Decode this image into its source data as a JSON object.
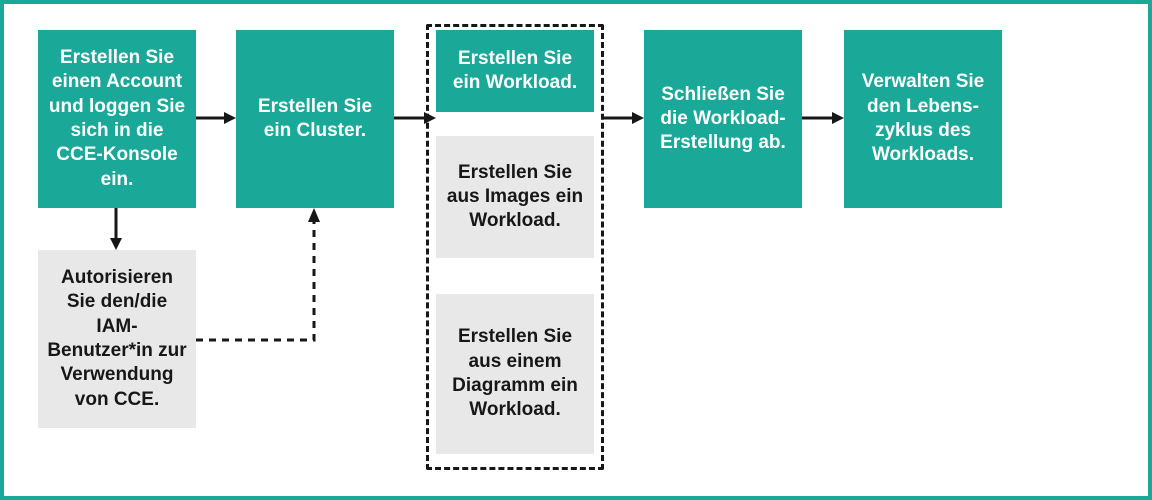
{
  "step1": "Erstellen Sie einen Account und loggen Sie sich in die CCE-Konsole ein.",
  "step1_sub": "Autorisieren Sie den/die IAM-Benutzer*in zur Verwendung von CCE.",
  "step2": "Erstellen Sie ein Cluster.",
  "step3": "Erstellen Sie ein Workload.",
  "step3_opt1": "Erstellen Sie aus Images ein Workload.",
  "step3_opt2": "Erstellen Sie aus einem Diagramm ein Workload.",
  "step4": "Schließen Sie die Workload-Erstellung ab.",
  "step5": "Verwalten Sie den Lebens-zyklus des Workloads."
}
